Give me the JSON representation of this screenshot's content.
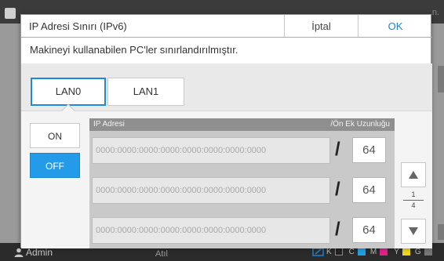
{
  "background": {
    "right_text": "n."
  },
  "dialog": {
    "title": "IP Adresi Sınırı (IPv6)",
    "cancel_label": "İptal",
    "ok_label": "OK",
    "message": "Makineyi kullanabilen PC'ler sınırlandırılmıştır."
  },
  "lan_tabs": [
    {
      "label": "LAN0",
      "selected": true
    },
    {
      "label": "LAN1",
      "selected": false
    }
  ],
  "toggle": {
    "on_label": "ON",
    "off_label": "OFF",
    "selected": "OFF"
  },
  "ip_table": {
    "header_ip": "IP Adresi",
    "header_prefix": "/Ön Ek Uzunluğu",
    "slash": "/",
    "rows": [
      {
        "address": "0000:0000:0000:0000:0000:0000:0000:0000",
        "prefix": "64"
      },
      {
        "address": "0000:0000:0000:0000:0000:0000:0000:0000",
        "prefix": "64"
      },
      {
        "address": "0000:0000:0000:0000:0000:0000:0000:0000",
        "prefix": "64"
      }
    ]
  },
  "pagination": {
    "current": "1",
    "total": "4"
  },
  "status_bar": {
    "user": "Admin",
    "middle": "Atıl",
    "inks": [
      {
        "letter": "K",
        "color": "#222222"
      },
      {
        "letter": "C",
        "color": "#1fa3e0"
      },
      {
        "letter": "M",
        "color": "#e0208c"
      },
      {
        "letter": "Y",
        "color": "#f1d51c"
      },
      {
        "letter": "G",
        "color": "#777777"
      }
    ]
  },
  "colors": {
    "accent": "#239be8",
    "ok_text": "#1c82d4"
  }
}
